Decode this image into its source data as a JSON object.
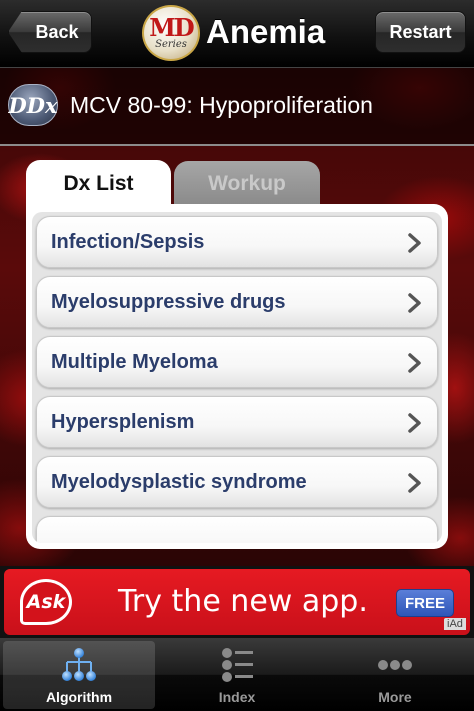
{
  "navbar": {
    "back_label": "Back",
    "logo_text": "MD",
    "logo_sub": "Series",
    "title": "Anemia",
    "restart_label": "Restart"
  },
  "subheader": {
    "badge": "DDx",
    "title": "MCV 80-99: Hypoproliferation"
  },
  "tabs": [
    {
      "label": "Dx List",
      "active": true
    },
    {
      "label": "Workup",
      "active": false
    }
  ],
  "list": {
    "items": [
      {
        "label": "Infection/Sepsis"
      },
      {
        "label": "Myelosuppressive drugs"
      },
      {
        "label": "Multiple Myeloma"
      },
      {
        "label": "Hypersplenism"
      },
      {
        "label": "Myelodysplastic syndrome"
      }
    ],
    "chevron_color": "#555555",
    "label_color": "#2b3d6b"
  },
  "ad": {
    "brand": "Ask",
    "text": "Try the new app.",
    "free_label": "FREE",
    "network": "iAd"
  },
  "tabbar": {
    "items": [
      {
        "label": "Algorithm",
        "icon": "algorithm-tree-icon",
        "selected": true
      },
      {
        "label": "Index",
        "icon": "list-index-icon",
        "selected": false
      },
      {
        "label": "More",
        "icon": "more-dots-icon",
        "selected": false
      }
    ]
  },
  "colors": {
    "background": "#5a0a0a",
    "accent_blue": "#2e56b8",
    "ad_red": "#e61a22"
  }
}
